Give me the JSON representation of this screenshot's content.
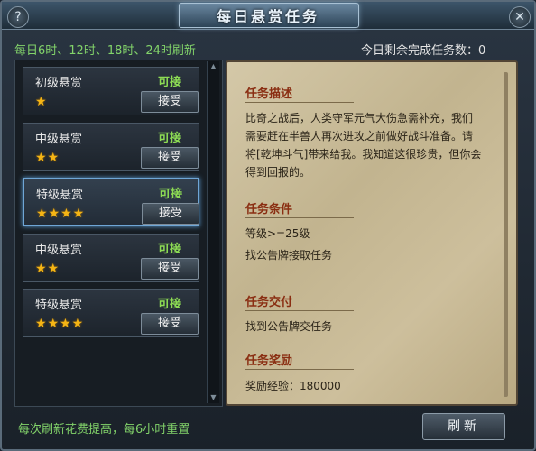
{
  "window": {
    "title": "每日悬赏任务",
    "help_glyph": "?",
    "close_glyph": "✕"
  },
  "header": {
    "refresh_note": "每日6时、12时、18时、24时刷新",
    "remaining_label": "今日剩余完成任务数：",
    "remaining_value": "0"
  },
  "tasks": [
    {
      "name": "初级悬赏",
      "status": "可接",
      "stars_count": 1,
      "stars": "★",
      "accept_label": "接受"
    },
    {
      "name": "中级悬赏",
      "status": "可接",
      "stars_count": 2,
      "stars": "★★",
      "accept_label": "接受"
    },
    {
      "name": "特级悬赏",
      "status": "可接",
      "stars_count": 4,
      "stars": "★★★★",
      "accept_label": "接受"
    },
    {
      "name": "中级悬赏",
      "status": "可接",
      "stars_count": 2,
      "stars": "★★",
      "accept_label": "接受"
    },
    {
      "name": "特级悬赏",
      "status": "可接",
      "stars_count": 4,
      "stars": "★★★★",
      "accept_label": "接受"
    }
  ],
  "selected_task_index": 2,
  "detail": {
    "desc_title": "任务描述",
    "desc_text": "比奇之战后，人类守军元气大伤急需补充，我们需要赶在半兽人再次进攻之前做好战斗准备。请将[乾坤斗气]带来给我。我知道这很珍贵，但你会得到回报的。",
    "cond_title": "任务条件",
    "cond_level": "等级>=25级",
    "cond_source": "找公告牌接取任务",
    "submit_title": "任务交付",
    "submit_text": "找到公告牌交任务",
    "reward_title": "任务奖励",
    "reward_text": "奖励经验：180000"
  },
  "footer": {
    "note": "每次刷新花费提高，每6小时重置",
    "refresh_label": "刷新"
  },
  "colors": {
    "accent_green": "#82d36a",
    "status_green": "#8ddc54",
    "star_gold": "#f5b515",
    "section_red": "#8a2e12",
    "selection_blue": "#6fa6d6"
  }
}
